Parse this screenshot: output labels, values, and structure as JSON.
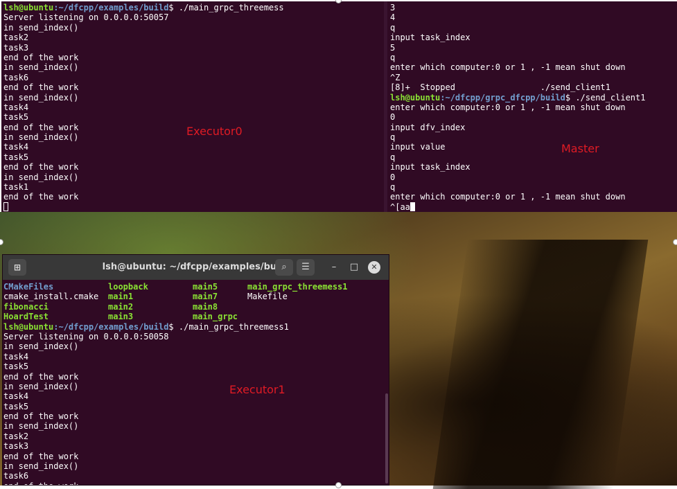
{
  "executor0": {
    "lines": [
      {
        "user": "lsh@ubuntu",
        "path": ":~/dfcpp/examples/build",
        "cmd": "$ ./main_grpc_threemess"
      },
      {
        "text": "Server listening on 0.0.0.0:50057"
      },
      {
        "text": "in send_index()"
      },
      {
        "text": "task2"
      },
      {
        "text": "task3"
      },
      {
        "text": "end of the work"
      },
      {
        "text": "in send_index()"
      },
      {
        "text": "task6"
      },
      {
        "text": "end of the work"
      },
      {
        "text": "in send_index()"
      },
      {
        "text": "task4"
      },
      {
        "text": "task5"
      },
      {
        "text": "end of the work"
      },
      {
        "text": "in send_index()"
      },
      {
        "text": "task4"
      },
      {
        "text": "task5"
      },
      {
        "text": "end of the work"
      },
      {
        "text": "in send_index()"
      },
      {
        "text": "task1"
      },
      {
        "text": "end of the work"
      }
    ],
    "label": "Executor0"
  },
  "master": {
    "lines": [
      {
        "text": "3"
      },
      {
        "text": "4"
      },
      {
        "text": "q"
      },
      {
        "text": "input task_index"
      },
      {
        "text": "5"
      },
      {
        "text": "q"
      },
      {
        "text": "enter which computer:0 or 1 , -1 mean shut down"
      },
      {
        "text": "^Z"
      },
      {
        "text": "[8]+  Stopped                 ./send_client1"
      },
      {
        "user": "lsh@ubuntu",
        "path": ":~/dfcpp/grpc_dfcpp/build",
        "cmd": "$ ./send_client1"
      },
      {
        "text": "enter which computer:0 or 1 , -1 mean shut down"
      },
      {
        "text": "0"
      },
      {
        "text": "input dfv_index"
      },
      {
        "text": "q"
      },
      {
        "text": "input value"
      },
      {
        "text": "q"
      },
      {
        "text": "input task_index"
      },
      {
        "text": "0"
      },
      {
        "text": "q"
      },
      {
        "text": "enter which computer:0 or 1 , -1 mean shut down"
      }
    ],
    "last_input": "^[aa",
    "label": "Master"
  },
  "executor1": {
    "window_title": "lsh@ubuntu: ~/dfcpp/examples/build",
    "ls_rows": [
      [
        {
          "name": "CMakeFiles",
          "kind": "dir"
        },
        {
          "name": "loopback",
          "kind": "exe"
        },
        {
          "name": "main5",
          "kind": "exe"
        },
        {
          "name": "main_grpc_threemess1",
          "kind": "exe"
        }
      ],
      [
        {
          "name": "cmake_install.cmake",
          "kind": "file"
        },
        {
          "name": "main1",
          "kind": "exe"
        },
        {
          "name": "main7",
          "kind": "exe"
        },
        {
          "name": "Makefile",
          "kind": "file"
        }
      ],
      [
        {
          "name": "fibonacci",
          "kind": "exe"
        },
        {
          "name": "main2",
          "kind": "exe"
        },
        {
          "name": "main8",
          "kind": "exe"
        },
        {
          "name": "",
          "kind": "file"
        }
      ],
      [
        {
          "name": "HoardTest",
          "kind": "exe"
        },
        {
          "name": "main3",
          "kind": "exe"
        },
        {
          "name": "main_grpc",
          "kind": "exe"
        },
        {
          "name": "",
          "kind": "file"
        }
      ]
    ],
    "lines": [
      {
        "user": "lsh@ubuntu",
        "path": ":~/dfcpp/examples/build",
        "cmd": "$ ./main_grpc_threemess1"
      },
      {
        "text": "Server listening on 0.0.0.0:50058"
      },
      {
        "text": "in send_index()"
      },
      {
        "text": "task4"
      },
      {
        "text": "task5"
      },
      {
        "text": "end of the work"
      },
      {
        "text": "in send_index()"
      },
      {
        "text": "task4"
      },
      {
        "text": "task5"
      },
      {
        "text": "end of the work"
      },
      {
        "text": "in send_index()"
      },
      {
        "text": "task2"
      },
      {
        "text": "task3"
      },
      {
        "text": "end of the work"
      },
      {
        "text": "in send_index()"
      },
      {
        "text": "task6"
      },
      {
        "text": "end of the work"
      }
    ],
    "label": "Executor1"
  },
  "colors": {
    "terminal_bg": "#300a24",
    "prompt_user": "#8ae234",
    "prompt_path": "#729fcf",
    "label": "#e01b24",
    "titlebar": "#383838"
  },
  "icons": {
    "new_tab": "new-tab-icon",
    "search": "search-icon",
    "menu": "hamburger-menu-icon",
    "minimize": "minimize-icon",
    "maximize": "maximize-icon",
    "close": "close-icon"
  }
}
